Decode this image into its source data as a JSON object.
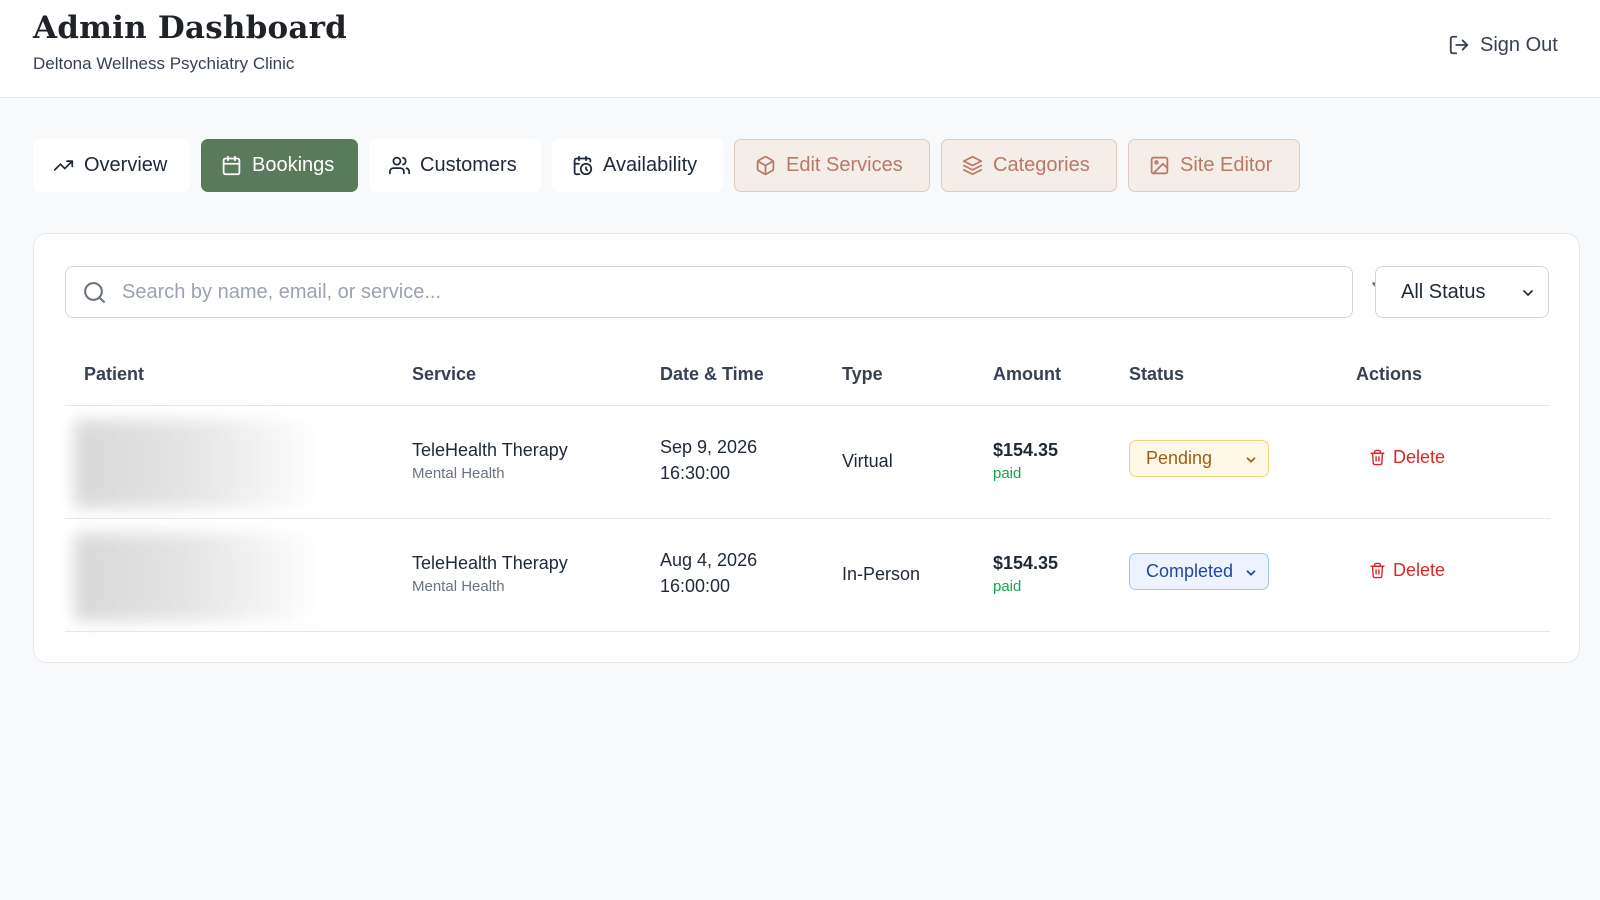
{
  "header": {
    "title": "Admin Dashboard",
    "subtitle": "Deltona Wellness Psychiatry Clinic",
    "sign_out_label": "Sign Out",
    "sign_out_icon": "log-out-icon"
  },
  "tabs": [
    {
      "label": "Overview",
      "icon": "trending-up-icon",
      "active": false
    },
    {
      "label": "Bookings",
      "icon": "calendar-icon",
      "active": true
    },
    {
      "label": "Customers",
      "icon": "users-icon",
      "active": false
    },
    {
      "label": "Availability",
      "icon": "calendar-clock-icon",
      "active": false
    },
    {
      "label": "Edit Services",
      "icon": "package-icon",
      "active": false
    },
    {
      "label": "Categories",
      "icon": "layers-icon",
      "active": false
    },
    {
      "label": "Site Editor",
      "icon": "image-icon",
      "active": false
    }
  ],
  "search": {
    "placeholder": "Search by name, email, or service...",
    "value": ""
  },
  "filter": {
    "icon": "filter-icon",
    "status_selected": "All Status"
  },
  "table": {
    "columns": [
      "Patient",
      "Service",
      "Date & Time",
      "Type",
      "Amount",
      "Status",
      "Actions"
    ],
    "rows": [
      {
        "patient": "",
        "service": "TeleHealth Therapy",
        "category": "Mental Health",
        "date": "Sep 9, 2026",
        "time": "16:30:00",
        "type": "Virtual",
        "amount": "$154.35",
        "payment": "paid",
        "status": "Pending",
        "action": "Delete"
      },
      {
        "patient": "",
        "service": "TeleHealth Therapy",
        "category": "Mental Health",
        "date": "Aug 4, 2026",
        "time": "16:00:00",
        "type": "In-Person",
        "amount": "$154.35",
        "payment": "paid",
        "status": "Completed",
        "action": "Delete"
      }
    ]
  },
  "colors": {
    "accent": "#5a7a5c",
    "warm_tab_bg": "#f5ede8",
    "warm_tab_text": "#b97a63",
    "paid": "#16a34a",
    "delete": "#dc2626",
    "pending_bg": "#fef8e7",
    "completed_bg": "#eef4ff"
  }
}
